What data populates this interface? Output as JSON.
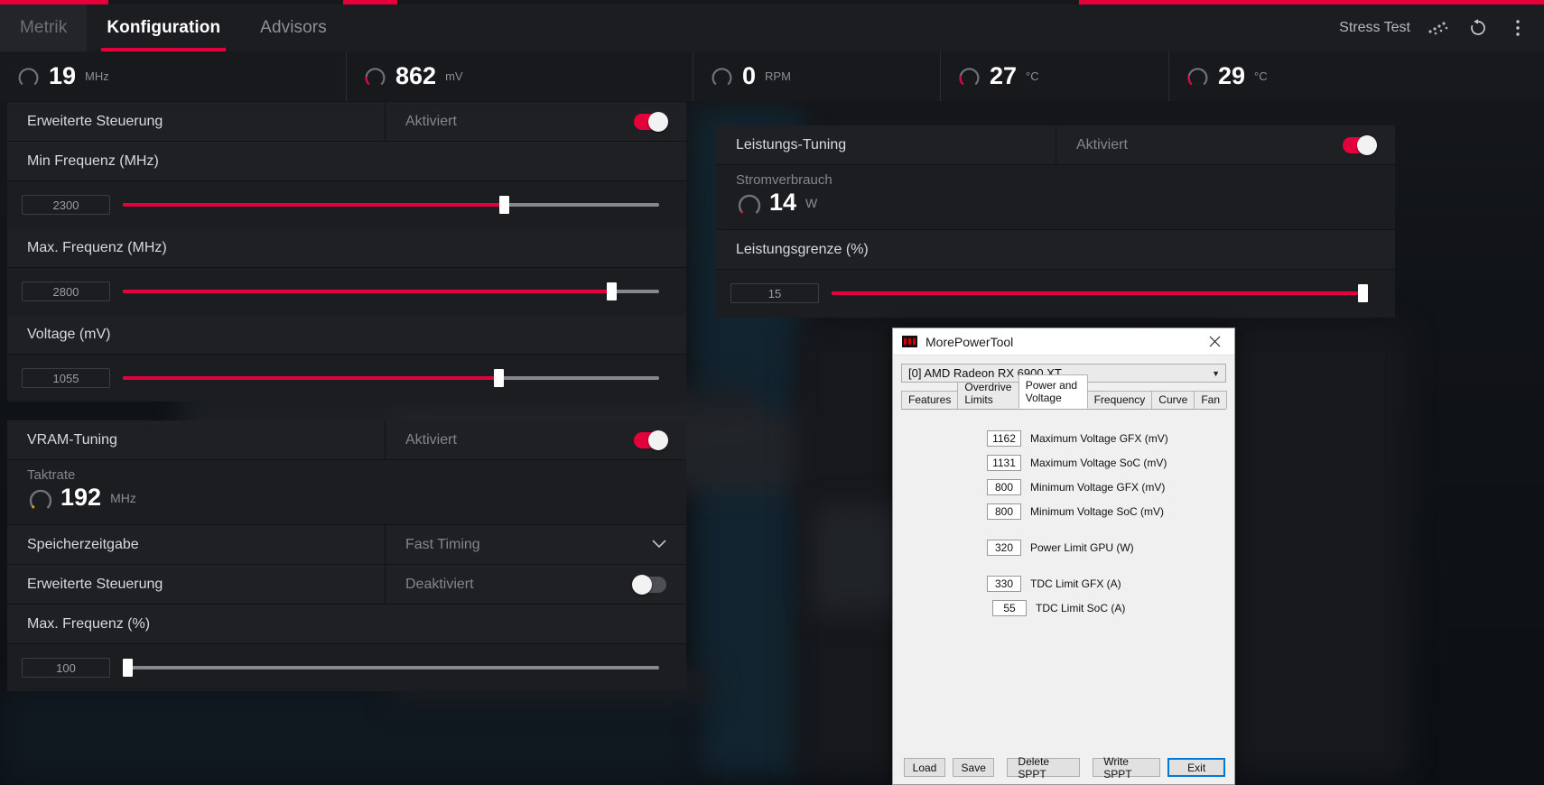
{
  "header": {
    "tabs": [
      {
        "label": "Metrik",
        "state": "dim"
      },
      {
        "label": "Konfiguration",
        "state": "active"
      },
      {
        "label": "Advisors",
        "state": "normal"
      }
    ],
    "stress_test_label": "Stress Test",
    "stress_test_icon": "dots-diagonal-icon",
    "reset_icon": "refresh-icon",
    "menu_icon": "kebab-menu-icon",
    "accent_color": "#e4003a"
  },
  "metrics": [
    {
      "value": "19",
      "unit": "MHz",
      "gauge_pct": 3
    },
    {
      "value": "862",
      "unit": "mV",
      "gauge_pct": 22
    },
    {
      "value": "0",
      "unit": "RPM",
      "gauge_pct": 0
    },
    {
      "value": "27",
      "unit": "°C",
      "gauge_pct": 27
    },
    {
      "value": "29",
      "unit": "°C",
      "gauge_pct": 29
    }
  ],
  "gpu_tuning": {
    "advanced_control": {
      "label": "Erweiterte Steuerung",
      "state": "Aktiviert",
      "on": true
    },
    "min_freq": {
      "label": "Min Frequenz (MHz)",
      "value": "2300",
      "pct": 61
    },
    "max_freq": {
      "label": "Max. Frequenz (MHz)",
      "value": "2800",
      "pct": 91
    },
    "voltage": {
      "label": "Voltage (mV)",
      "value": "1055",
      "pct": 70
    }
  },
  "vram_tuning": {
    "title": "VRAM-Tuning",
    "state": "Aktiviert",
    "on": true,
    "clock": {
      "caption": "Taktrate",
      "value": "192",
      "unit": "MHz"
    },
    "memory_timing": {
      "label": "Speicherzeitgabe",
      "value": "Fast Timing",
      "chevron": "chevron-down-icon"
    },
    "advanced_control": {
      "label": "Erweiterte Steuerung",
      "state": "Deaktiviert",
      "on": false
    },
    "max_freq": {
      "label": "Max. Frequenz (%)",
      "value": "100",
      "pct": 0
    }
  },
  "power_tuning": {
    "title": "Leistungs-Tuning",
    "state": "Aktiviert",
    "on": true,
    "power_draw": {
      "caption": "Stromverbrauch",
      "value": "14",
      "unit": "W"
    },
    "power_limit": {
      "label": "Leistungsgrenze (%)",
      "value": "15",
      "pct": 99
    }
  },
  "mpt": {
    "title": "MorePowerTool",
    "close_icon": "close-icon",
    "device": "[0] AMD Radeon RX 6900 XT",
    "tabs": [
      {
        "label": "Features",
        "selected": false
      },
      {
        "label": "Overdrive Limits",
        "selected": false
      },
      {
        "label": "Power and Voltage",
        "selected": true
      },
      {
        "label": "Frequency",
        "selected": false
      },
      {
        "label": "Curve",
        "selected": false
      },
      {
        "label": "Fan",
        "selected": false
      }
    ],
    "fields": [
      {
        "value": "1162",
        "name": "Maximum Voltage GFX (mV)",
        "gap": false
      },
      {
        "value": "1131",
        "name": "Maximum Voltage SoC (mV)",
        "gap": false
      },
      {
        "value": "800",
        "name": "Minimum Voltage GFX (mV)",
        "gap": false
      },
      {
        "value": "800",
        "name": "Minimum Voltage SoC (mV)",
        "gap": false
      },
      {
        "value": "320",
        "name": "Power Limit GPU (W)",
        "gap": true
      },
      {
        "value": "330",
        "name": "TDC Limit GFX (A)",
        "gap": true
      },
      {
        "value": "55",
        "name": "TDC Limit SoC (A)",
        "gap": false
      }
    ],
    "buttons": [
      {
        "label": "Load",
        "primary": false
      },
      {
        "label": "Save",
        "primary": false
      },
      {
        "label": "Delete SPPT",
        "primary": false
      },
      {
        "label": "Write SPPT",
        "primary": false
      }
    ],
    "exit_button": "Exit"
  }
}
